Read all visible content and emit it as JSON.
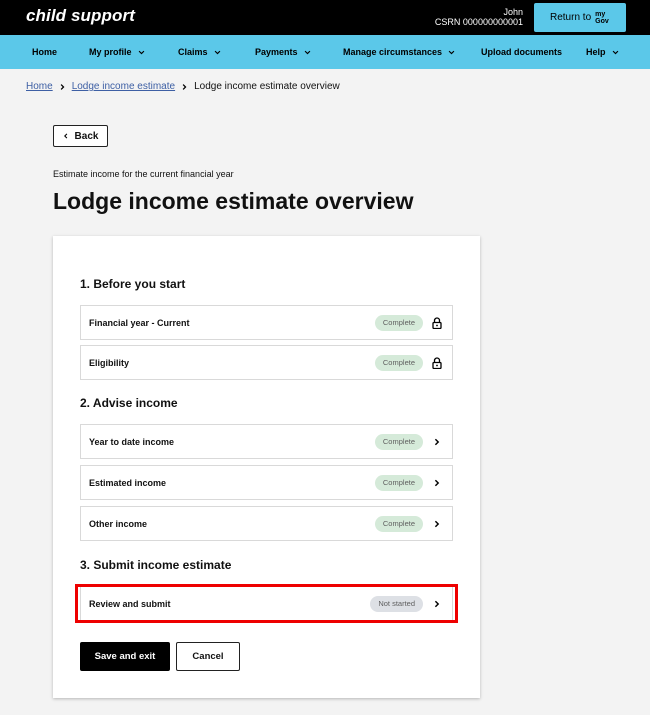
{
  "header": {
    "brand": "child support",
    "user_name": "John",
    "csrn": "CSRN 000000000001",
    "return_label": "Return to",
    "mygov_top": "my",
    "mygov_bottom": "Gov"
  },
  "nav": {
    "items": [
      {
        "label": "Home",
        "has_chevron": false
      },
      {
        "label": "My profile",
        "has_chevron": true
      },
      {
        "label": "Claims",
        "has_chevron": true
      },
      {
        "label": "Payments",
        "has_chevron": true
      },
      {
        "label": "Manage circumstances",
        "has_chevron": true
      },
      {
        "label": "Upload documents",
        "has_chevron": false
      },
      {
        "label": "Help",
        "has_chevron": true
      }
    ]
  },
  "breadcrumb": {
    "items": [
      "Home",
      "Lodge income estimate",
      "Lodge income estimate overview"
    ]
  },
  "back_label": "Back",
  "page": {
    "subtitle": "Estimate income for the current financial year",
    "title": "Lodge income estimate overview"
  },
  "sections": [
    {
      "title": "1. Before you start",
      "rows": [
        {
          "label": "Financial year - Current",
          "status": "Complete",
          "icon": "lock-icon"
        },
        {
          "label": "Eligibility",
          "status": "Complete",
          "icon": "lock-icon"
        }
      ]
    },
    {
      "title": "2. Advise income",
      "rows": [
        {
          "label": "Year to date income",
          "status": "Complete",
          "icon": "chevron-right-icon"
        },
        {
          "label": "Estimated income",
          "status": "Complete",
          "icon": "chevron-right-icon"
        },
        {
          "label": "Other income",
          "status": "Complete",
          "icon": "chevron-right-icon"
        }
      ]
    },
    {
      "title": "3. Submit income estimate",
      "rows": [
        {
          "label": "Review and submit",
          "status": "Not started",
          "icon": "chevron-right-icon"
        }
      ]
    }
  ],
  "actions": {
    "save_label": "Save and exit",
    "cancel_label": "Cancel"
  },
  "colors": {
    "nav_bg": "#5bc8e9",
    "complete_pill": "#d5ead9",
    "not_started_pill": "#dde0e5",
    "highlight": "#ee0000"
  }
}
